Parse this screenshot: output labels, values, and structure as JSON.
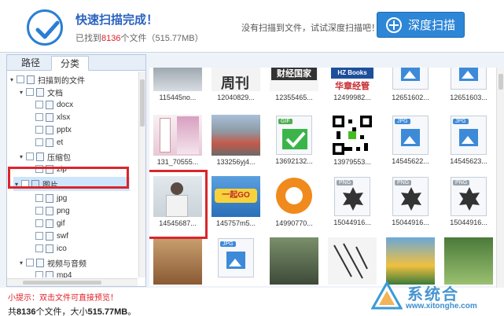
{
  "header": {
    "title": "快速扫描完成！",
    "found_prefix": "已找到",
    "found_count": "8136",
    "found_suffix": "个文件（515.77MB）",
    "tip": "没有扫描到文件，试试深度扫描吧！",
    "deep_scan_label": "深度扫描"
  },
  "tabs": {
    "path": "路径",
    "category": "分类"
  },
  "tree": {
    "root": "扫描到的文件",
    "doc": "文档",
    "docx": "docx",
    "xlsx": "xlsx",
    "pptx": "pptx",
    "et": "et",
    "zip_group": "压缩包",
    "zip": "zip",
    "images": "图片",
    "jpg": "jpg",
    "png": "png",
    "gif": "gif",
    "swf": "swf",
    "ico": "ico",
    "av": "视频与音频",
    "mp4": "mp4"
  },
  "files": [
    "115445no...",
    "12040829...",
    "12355465...",
    "12499982...",
    "12651602...",
    "12651603...",
    "131_70555...",
    "133256yj4...",
    "13692132...",
    "13979553...",
    "14545622...",
    "14545623...",
    "14545687...",
    "145757m5...",
    "14990770...",
    "15044916...",
    "15044916...",
    "15044916..."
  ],
  "thumb_text": {
    "magazine": "周刊",
    "finance": "财经国家",
    "hz_books": "HZ Books",
    "hz_sub": "华章经管",
    "promo": "一起GO"
  },
  "badges": {
    "gif": "GIF",
    "jpg": "JPG",
    "png": "PNG"
  },
  "footer": {
    "tip": "小提示：双击文件可直接预览！",
    "summary_prefix": "共",
    "summary_count": "8136",
    "summary_mid": "个文件，大小",
    "summary_size": "515.77MB",
    "summary_end": "。"
  },
  "watermark": {
    "text": "系统合",
    "url": "www.xitonghe.com"
  },
  "colors": {
    "accent": "#2e86d6",
    "title": "#2a63c0",
    "highlight": "#d9262c"
  }
}
